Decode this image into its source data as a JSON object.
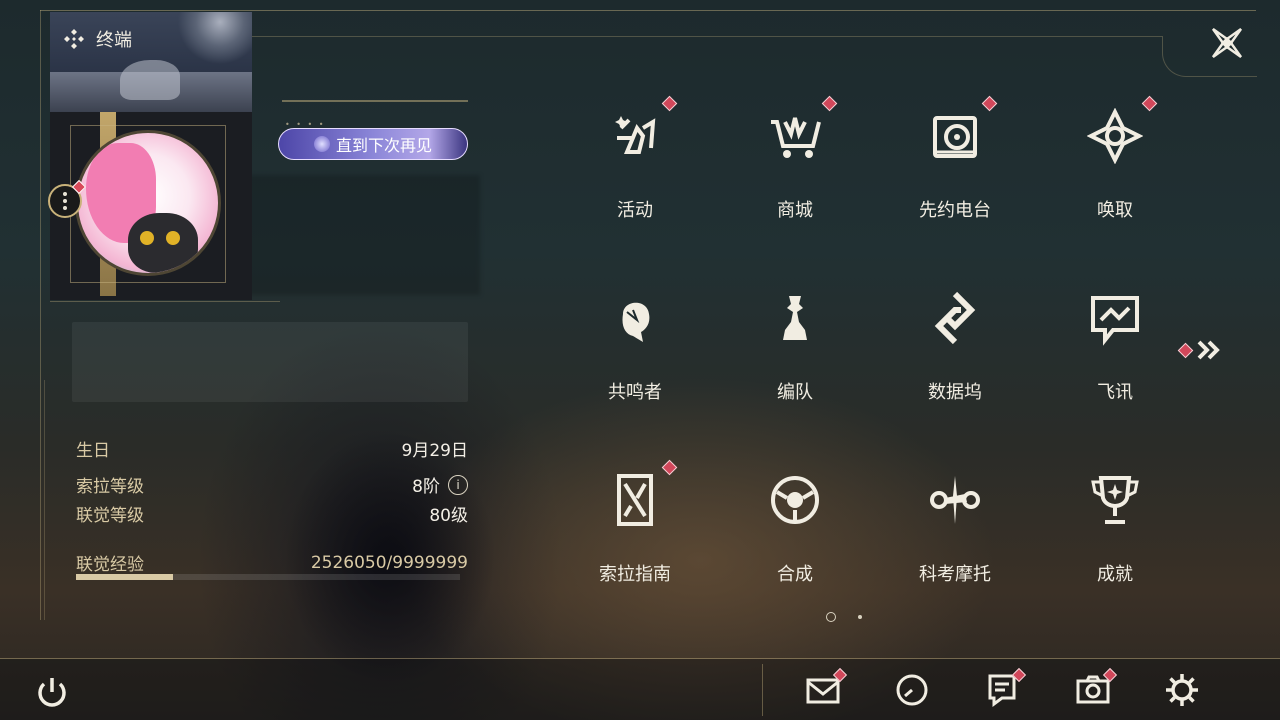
{
  "header": {
    "title": "终端",
    "icon": "diamond-cluster-icon"
  },
  "profile": {
    "nameplate_text": "直到下次再见",
    "stats": [
      {
        "label": "生日",
        "value": "9月29日"
      },
      {
        "label": "索拉等级",
        "value": "8阶"
      },
      {
        "label": "联觉等级",
        "value": "80级"
      }
    ],
    "experience": {
      "label": "联觉经验",
      "value": "2526050/9999999",
      "progress": 0.2526
    }
  },
  "menu": {
    "items": [
      {
        "label": "活动",
        "icon": "activity-icon",
        "badge": true
      },
      {
        "label": "商城",
        "icon": "shop-cart-icon",
        "badge": true
      },
      {
        "label": "先约电台",
        "icon": "radio-icon",
        "badge": true
      },
      {
        "label": "唤取",
        "icon": "summon-compass-icon",
        "badge": true
      },
      {
        "label": "共鸣者",
        "icon": "resonator-head-icon",
        "badge": false
      },
      {
        "label": "编队",
        "icon": "team-chess-icon",
        "badge": false
      },
      {
        "label": "数据坞",
        "icon": "data-dock-icon",
        "badge": false
      },
      {
        "label": "飞讯",
        "icon": "messenger-icon",
        "badge": false
      },
      {
        "label": "索拉指南",
        "icon": "guide-book-icon",
        "badge": true
      },
      {
        "label": "合成",
        "icon": "synthesis-icon",
        "badge": false
      },
      {
        "label": "科考摩托",
        "icon": "motorcycle-icon",
        "badge": false
      },
      {
        "label": "成就",
        "icon": "trophy-icon",
        "badge": false
      }
    ],
    "page_indicator": {
      "current": 1,
      "total": 2
    }
  },
  "bottom_bar": {
    "buttons": [
      "power-icon",
      "mail-icon",
      "clock-icon",
      "notice-icon",
      "camera-icon",
      "settings-gear-icon"
    ]
  },
  "colors": {
    "accent_gold": "#d9caa5",
    "badge_red": "#d1475a",
    "nameplate_purple": "#8b86d8"
  }
}
